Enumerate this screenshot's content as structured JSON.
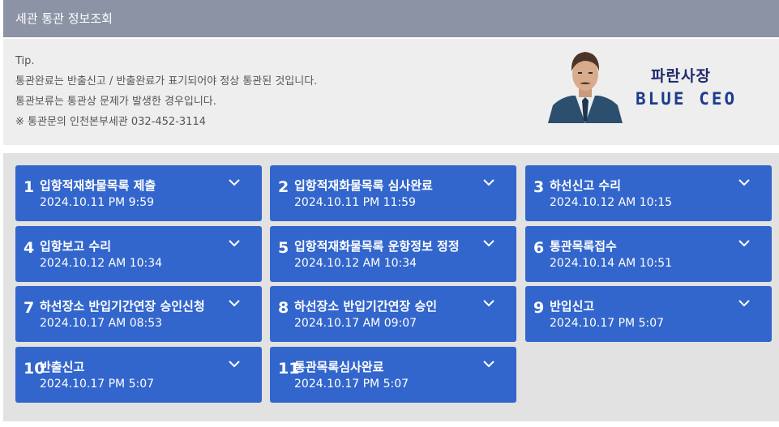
{
  "header": {
    "title": "세관 통관 정보조회"
  },
  "tip": {
    "lines": [
      "Tip.",
      "통관완료는 반출신고 / 반출완료가 표기되어야 정상 통관된 것입니다.",
      "통관보류는 통관상 문제가 발생한 경우입니다.",
      "※ 통관문의 인천본부세관 032-452-3114"
    ]
  },
  "logo": {
    "korean": "파란사장",
    "english": "BLUE CEO"
  },
  "cards": [
    {
      "num": "1",
      "title": "입항적재화물목록 제출",
      "date": "2024.10.11 PM 9:59"
    },
    {
      "num": "2",
      "title": "입항적재화물목록 심사완료",
      "date": "2024.10.11 PM 11:59"
    },
    {
      "num": "3",
      "title": "하선신고 수리",
      "date": "2024.10.12 AM 10:15"
    },
    {
      "num": "4",
      "title": "입항보고 수리",
      "date": "2024.10.12 AM 10:34"
    },
    {
      "num": "5",
      "title": "입항적재화물목록 운항정보 정정",
      "date": "2024.10.12 AM 10:34"
    },
    {
      "num": "6",
      "title": "통관목록접수",
      "date": "2024.10.14 AM 10:51"
    },
    {
      "num": "7",
      "title": "하선장소 반입기간연장 승인신청",
      "date": "2024.10.17 AM 08:53"
    },
    {
      "num": "8",
      "title": "하선장소 반입기간연장 승인",
      "date": "2024.10.17 AM 09:07"
    },
    {
      "num": "9",
      "title": "반입신고",
      "date": "2024.10.17 PM 5:07"
    },
    {
      "num": "10",
      "title": "반출신고",
      "date": "2024.10.17 PM 5:07"
    },
    {
      "num": "11",
      "title": "통관목록심사완료",
      "date": "2024.10.17 PM 5:07"
    }
  ],
  "icons": {
    "card_toggle": "chevron-down-icon",
    "logo_portrait": "businessman-portrait"
  }
}
